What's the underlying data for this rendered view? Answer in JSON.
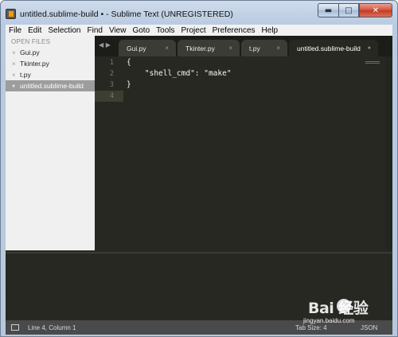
{
  "window": {
    "title": "untitled.sublime-build • - Sublime Text (UNREGISTERED)",
    "controls": {
      "minimize": "▬",
      "maximize": "□",
      "close": "✕"
    }
  },
  "menu": [
    "File",
    "Edit",
    "Selection",
    "Find",
    "View",
    "Goto",
    "Tools",
    "Project",
    "Preferences",
    "Help"
  ],
  "sidebar": {
    "header": "OPEN FILES",
    "files": [
      {
        "name": "Gui.py",
        "marker": "×",
        "active": false
      },
      {
        "name": "Tkinter.py",
        "marker": "×",
        "active": false
      },
      {
        "name": "t.py",
        "marker": "×",
        "active": false
      },
      {
        "name": "untitled.sublime-build",
        "marker": "●",
        "active": true
      }
    ]
  },
  "tabbar": {
    "nav_arrows": "◀ ▶",
    "tabs": [
      {
        "label": "Gui.py",
        "close": "×",
        "active": false
      },
      {
        "label": "Tkinter.py",
        "close": "×",
        "active": false
      },
      {
        "label": "t.py",
        "close": "×",
        "active": false
      },
      {
        "label": "untitled.sublime-build",
        "close": "●",
        "active": true
      }
    ]
  },
  "editor": {
    "line_numbers": [
      "1",
      "2",
      "3",
      "4"
    ],
    "lines": [
      "{",
      "    \"shell_cmd\": \"make\"",
      "}",
      ""
    ],
    "current_line": 4
  },
  "status": {
    "position": "Line 4, Column 1",
    "tab_size": "Tab Size: 4",
    "syntax": "JSON"
  },
  "watermark": {
    "brand": "Bai  经验",
    "url": "jingyan.baidu.com"
  },
  "colors": {
    "editor_bg": "#272822",
    "tabbar_bg": "#1c1d19",
    "sidebar_bg": "#f0f0f0",
    "status_bg": "#4a4a4a"
  }
}
